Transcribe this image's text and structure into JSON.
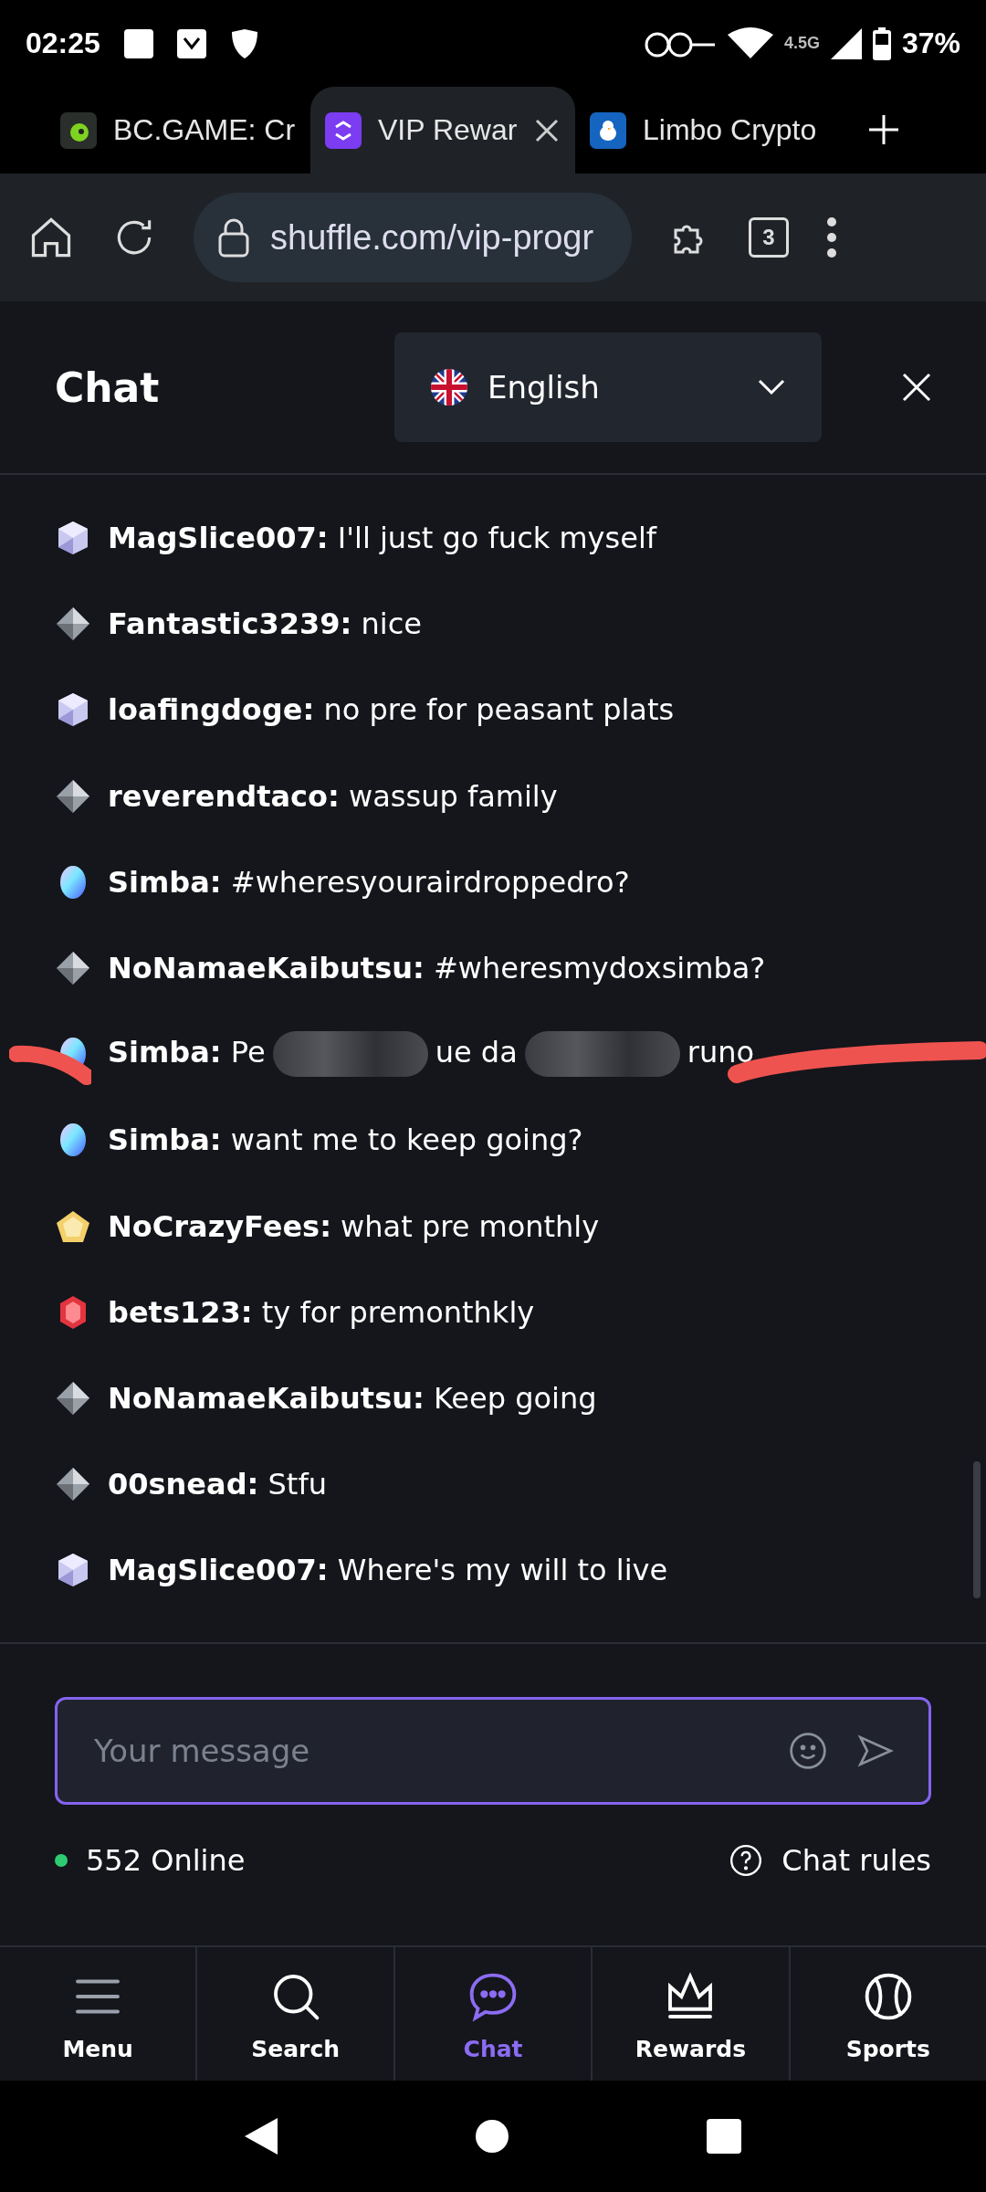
{
  "status_bar": {
    "time": "02:25",
    "battery": "37%",
    "network": "4.5G"
  },
  "browser_tabs": [
    {
      "title": "BC.GAME: Cr",
      "selected": false,
      "kind": "bc"
    },
    {
      "title": "VIP Rewar",
      "selected": true,
      "kind": "shuffle"
    },
    {
      "title": "Limbo Crypto",
      "selected": false,
      "kind": "duck"
    }
  ],
  "toolbar": {
    "url": "shuffle.com/vip-progr",
    "tab_count": "3"
  },
  "chat": {
    "title": "Chat",
    "language": "English",
    "messages": [
      {
        "kind": "platinum",
        "user": "MagSlice007:",
        "text": "I'll just go fuck myself"
      },
      {
        "kind": "diamond",
        "user": "Fantastic3239:",
        "text": "nice"
      },
      {
        "kind": "platinum",
        "user": "loafingdoge:",
        "text": "no pre for peasant plats"
      },
      {
        "kind": "diamond",
        "user": "reverendtaco:",
        "text": "wassup family"
      },
      {
        "kind": "opal",
        "user": "Simba:",
        "text": "#wheresyourairdroppedro?"
      },
      {
        "kind": "diamond",
        "user": "NoNamaeKaibutsu:",
        "text": "#wheresmydoxsimba?"
      },
      {
        "kind": "opal",
        "user": "Simba:",
        "parts": [
          "Pe",
          "ue da",
          "runo"
        ]
      },
      {
        "kind": "opal",
        "user": "Simba:",
        "text": "want me to keep going?"
      },
      {
        "kind": "gold",
        "user": "NoCrazyFees:",
        "text": "what pre monthly"
      },
      {
        "kind": "ruby",
        "user": "bets123:",
        "text": "ty for premonthkly"
      },
      {
        "kind": "diamond",
        "user": "NoNamaeKaibutsu:",
        "text": "Keep going"
      },
      {
        "kind": "diamond",
        "user": "00snead:",
        "text": "Stfu"
      },
      {
        "kind": "platinum",
        "user": "MagSlice007:",
        "text": "Where's my will to live"
      }
    ],
    "input": {
      "placeholder": "Your message"
    },
    "online": "552 Online",
    "rules": "Chat rules"
  },
  "bottom_nav": [
    {
      "label": "Menu",
      "kind": "menu",
      "selected": false
    },
    {
      "label": "Search",
      "kind": "search",
      "selected": false
    },
    {
      "label": "Chat",
      "kind": "chat",
      "selected": true
    },
    {
      "label": "Rewards",
      "kind": "crown",
      "selected": false
    },
    {
      "label": "Sports",
      "kind": "ball",
      "selected": false
    }
  ]
}
